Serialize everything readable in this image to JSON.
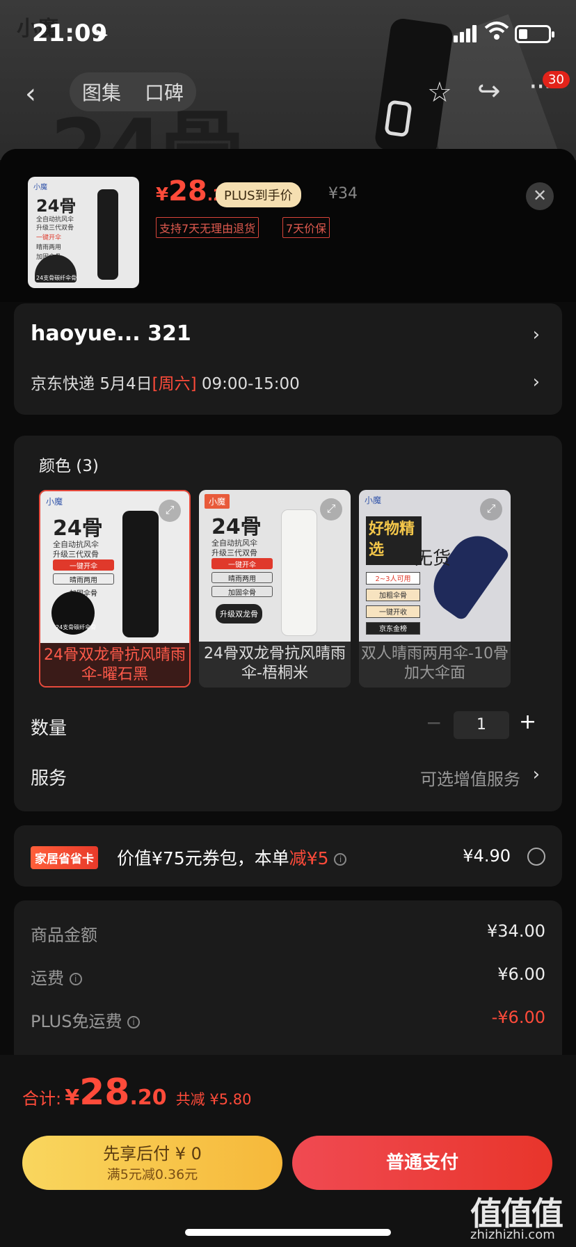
{
  "status": {
    "time": "21:09"
  },
  "nav": {
    "tab_gallery": "图集",
    "tab_reviews": "口碑",
    "more_badge": "30"
  },
  "background": {
    "big_text": "24骨",
    "logo": "小魔"
  },
  "product": {
    "price_currency": "¥",
    "price_int": "28",
    "price_dec": ".2",
    "plus_tag": "PLUS到手价",
    "original_price": "¥34",
    "tags": [
      "支持7天无理由退货",
      "7天价保"
    ],
    "thumb": {
      "brand": "小魔",
      "big": "24骨",
      "line1": "全自动抗风伞",
      "line2": "升级三代双骨",
      "line3": "一键开伞",
      "line4": "晴雨两用",
      "line5": "加固伞骨",
      "line6": "24支骨碳纤伞骨"
    }
  },
  "address": {
    "name": "haoyue...  321",
    "carrier": "京东快递",
    "date": "5月4日",
    "weekday": "[周六]",
    "window": "09:00-15:00"
  },
  "colors": {
    "title": "颜色 (3)",
    "options": [
      {
        "label": "24骨双龙骨抗风晴雨伞-曜石黑",
        "brand": "小魔",
        "big": "24骨",
        "l1": "全自动抗风伞",
        "l2": "升级三代双骨",
        "p1": "一键开伞",
        "p2": "晴雨两用",
        "p3": "加固伞骨",
        "p4": "24支骨碳纤伞骨"
      },
      {
        "label": "24骨双龙骨抗风晴雨伞-梧桐米",
        "brand": "小魔",
        "big": "24骨",
        "l1": "全自动抗风伞",
        "l2": "升级三代双骨",
        "p1": "一键开伞",
        "p2": "晴雨两用",
        "p3": "加固伞骨",
        "p4": "升级双龙骨"
      },
      {
        "label": "双人晴雨两用伞-10骨加大伞面",
        "brand": "小魔",
        "sign": "好物精选",
        "nostock": "无货",
        "g1": "2~3人可用",
        "g2": "加粗伞骨",
        "g3": "一键开收",
        "g4": "京东金榜"
      }
    ]
  },
  "quantity": {
    "label": "数量",
    "value": "1"
  },
  "service": {
    "label": "服务",
    "value": "可选增值服务"
  },
  "home_card": {
    "tag": "家居省省卡",
    "text_a": "价值¥75元券包，本单",
    "text_hl": "减¥5",
    "price": "¥4.90"
  },
  "summary": {
    "rows": [
      {
        "label": "商品金额",
        "value": "¥34.00"
      },
      {
        "label": "运费",
        "value": "¥6.00"
      },
      {
        "label": "PLUS免运费",
        "value": "-¥6.00"
      }
    ]
  },
  "footer": {
    "total_label": "合计:",
    "total_currency": "¥",
    "total_int": "28",
    "total_dec": ".20",
    "total_save": "共减 ¥5.80",
    "later_line1": "先享后付 ¥ 0",
    "later_line2": "满5元减0.36元",
    "pay_label": "普通支付",
    "watermark": "值值值",
    "watermark_sub": "zhizhizhi.com"
  }
}
